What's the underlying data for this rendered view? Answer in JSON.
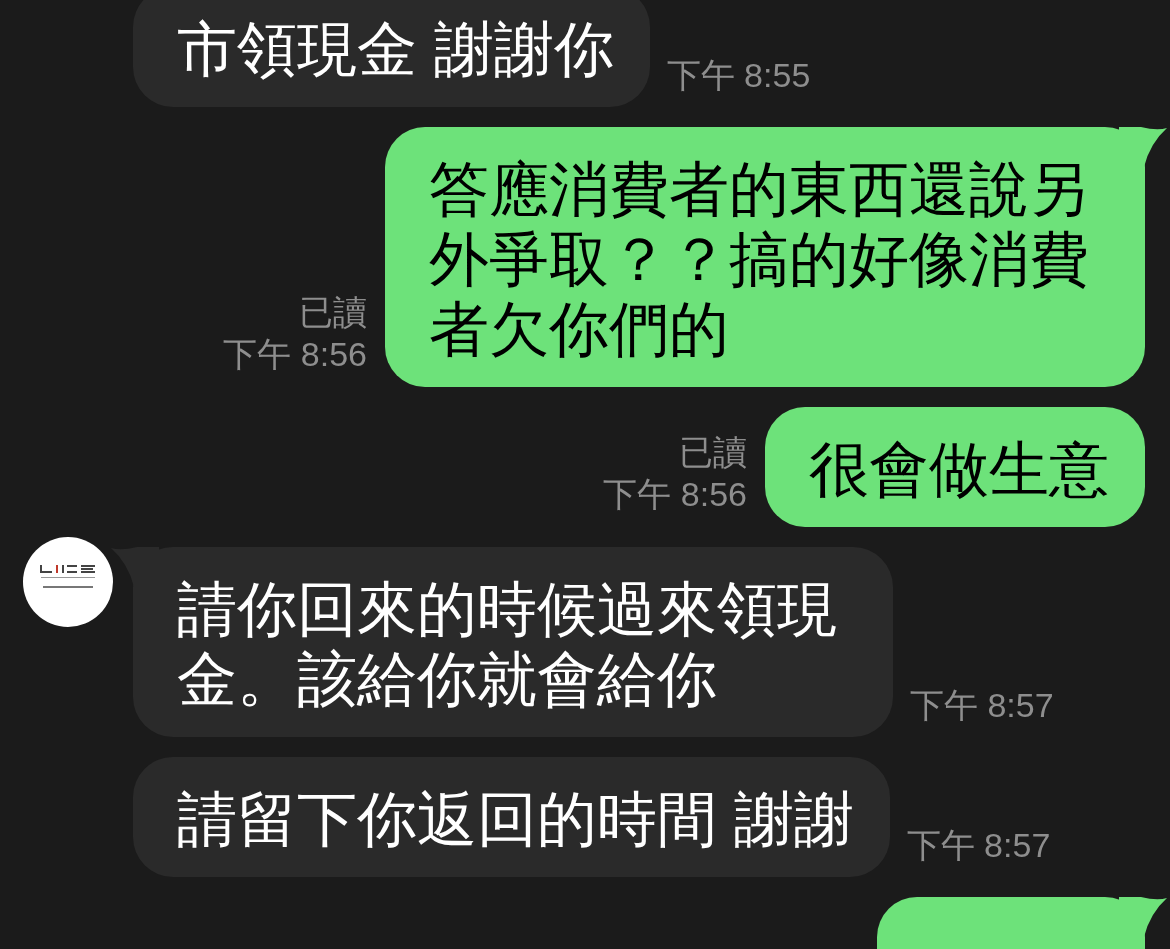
{
  "messages": [
    {
      "kind": "incoming",
      "avatar": false,
      "tail": false,
      "text": "市領現金 謝謝你",
      "time": "下午 8:55"
    },
    {
      "kind": "outgoing",
      "tail": true,
      "read": "已讀",
      "time": "下午 8:56",
      "text": "答應消費者的東西還說另外爭取？？搞的好像消費者欠你們的"
    },
    {
      "kind": "outgoing",
      "tail": false,
      "read": "已讀",
      "time": "下午 8:56",
      "text": "很會做生意"
    },
    {
      "kind": "incoming",
      "avatar": true,
      "tail": true,
      "text": "請你回來的時候過來領現金。該給你就會給你",
      "time": "下午 8:57"
    },
    {
      "kind": "incoming",
      "avatar": false,
      "tail": false,
      "text": "請留下你返回的時間 謝謝",
      "time": "下午 8:57"
    },
    {
      "kind": "outgoing",
      "tail": true
    }
  ]
}
